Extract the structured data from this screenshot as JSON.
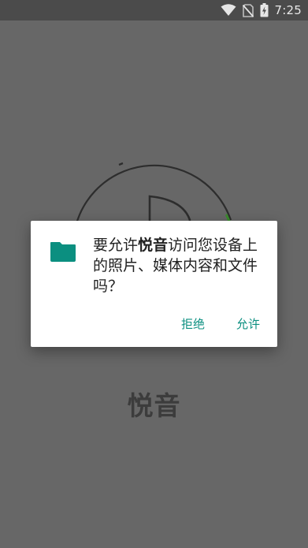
{
  "status_bar": {
    "time": "7:25",
    "icons": [
      "wifi-icon",
      "no-sim-icon",
      "battery-charging-icon"
    ]
  },
  "splash": {
    "app_name": "悦音"
  },
  "dialog": {
    "message_prefix": "要允许",
    "app_name": "悦音",
    "message_suffix": "访问您设备上的照片、媒体内容和文件吗？",
    "icon": "folder-icon",
    "deny_label": "拒绝",
    "allow_label": "允许"
  },
  "colors": {
    "accent": "#0b8f80",
    "scrim": "#676767",
    "status_bar": "#4b4b4b"
  }
}
